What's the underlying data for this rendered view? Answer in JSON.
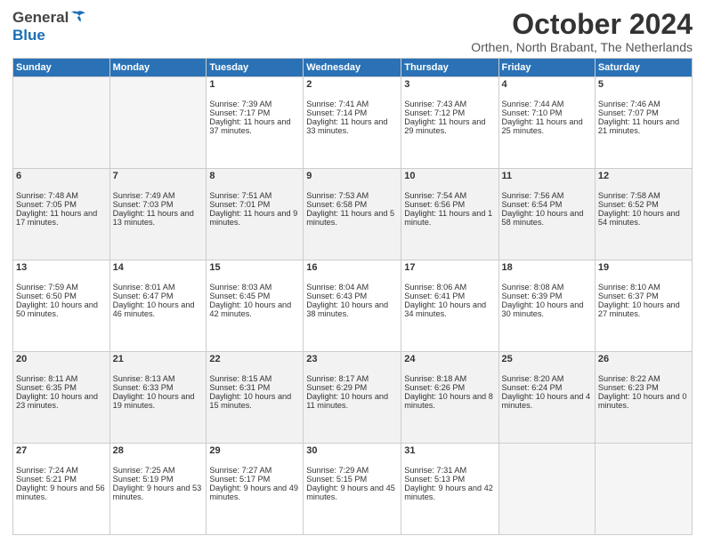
{
  "header": {
    "logo_general": "General",
    "logo_blue": "Blue",
    "title": "October 2024",
    "location": "Orthen, North Brabant, The Netherlands"
  },
  "days_of_week": [
    "Sunday",
    "Monday",
    "Tuesday",
    "Wednesday",
    "Thursday",
    "Friday",
    "Saturday"
  ],
  "weeks": [
    [
      {
        "day": "",
        "empty": true
      },
      {
        "day": "",
        "empty": true
      },
      {
        "day": "1",
        "sunrise": "Sunrise: 7:39 AM",
        "sunset": "Sunset: 7:17 PM",
        "daylight": "Daylight: 11 hours and 37 minutes."
      },
      {
        "day": "2",
        "sunrise": "Sunrise: 7:41 AM",
        "sunset": "Sunset: 7:14 PM",
        "daylight": "Daylight: 11 hours and 33 minutes."
      },
      {
        "day": "3",
        "sunrise": "Sunrise: 7:43 AM",
        "sunset": "Sunset: 7:12 PM",
        "daylight": "Daylight: 11 hours and 29 minutes."
      },
      {
        "day": "4",
        "sunrise": "Sunrise: 7:44 AM",
        "sunset": "Sunset: 7:10 PM",
        "daylight": "Daylight: 11 hours and 25 minutes."
      },
      {
        "day": "5",
        "sunrise": "Sunrise: 7:46 AM",
        "sunset": "Sunset: 7:07 PM",
        "daylight": "Daylight: 11 hours and 21 minutes."
      }
    ],
    [
      {
        "day": "6",
        "sunrise": "Sunrise: 7:48 AM",
        "sunset": "Sunset: 7:05 PM",
        "daylight": "Daylight: 11 hours and 17 minutes."
      },
      {
        "day": "7",
        "sunrise": "Sunrise: 7:49 AM",
        "sunset": "Sunset: 7:03 PM",
        "daylight": "Daylight: 11 hours and 13 minutes."
      },
      {
        "day": "8",
        "sunrise": "Sunrise: 7:51 AM",
        "sunset": "Sunset: 7:01 PM",
        "daylight": "Daylight: 11 hours and 9 minutes."
      },
      {
        "day": "9",
        "sunrise": "Sunrise: 7:53 AM",
        "sunset": "Sunset: 6:58 PM",
        "daylight": "Daylight: 11 hours and 5 minutes."
      },
      {
        "day": "10",
        "sunrise": "Sunrise: 7:54 AM",
        "sunset": "Sunset: 6:56 PM",
        "daylight": "Daylight: 11 hours and 1 minute."
      },
      {
        "day": "11",
        "sunrise": "Sunrise: 7:56 AM",
        "sunset": "Sunset: 6:54 PM",
        "daylight": "Daylight: 10 hours and 58 minutes."
      },
      {
        "day": "12",
        "sunrise": "Sunrise: 7:58 AM",
        "sunset": "Sunset: 6:52 PM",
        "daylight": "Daylight: 10 hours and 54 minutes."
      }
    ],
    [
      {
        "day": "13",
        "sunrise": "Sunrise: 7:59 AM",
        "sunset": "Sunset: 6:50 PM",
        "daylight": "Daylight: 10 hours and 50 minutes."
      },
      {
        "day": "14",
        "sunrise": "Sunrise: 8:01 AM",
        "sunset": "Sunset: 6:47 PM",
        "daylight": "Daylight: 10 hours and 46 minutes."
      },
      {
        "day": "15",
        "sunrise": "Sunrise: 8:03 AM",
        "sunset": "Sunset: 6:45 PM",
        "daylight": "Daylight: 10 hours and 42 minutes."
      },
      {
        "day": "16",
        "sunrise": "Sunrise: 8:04 AM",
        "sunset": "Sunset: 6:43 PM",
        "daylight": "Daylight: 10 hours and 38 minutes."
      },
      {
        "day": "17",
        "sunrise": "Sunrise: 8:06 AM",
        "sunset": "Sunset: 6:41 PM",
        "daylight": "Daylight: 10 hours and 34 minutes."
      },
      {
        "day": "18",
        "sunrise": "Sunrise: 8:08 AM",
        "sunset": "Sunset: 6:39 PM",
        "daylight": "Daylight: 10 hours and 30 minutes."
      },
      {
        "day": "19",
        "sunrise": "Sunrise: 8:10 AM",
        "sunset": "Sunset: 6:37 PM",
        "daylight": "Daylight: 10 hours and 27 minutes."
      }
    ],
    [
      {
        "day": "20",
        "sunrise": "Sunrise: 8:11 AM",
        "sunset": "Sunset: 6:35 PM",
        "daylight": "Daylight: 10 hours and 23 minutes."
      },
      {
        "day": "21",
        "sunrise": "Sunrise: 8:13 AM",
        "sunset": "Sunset: 6:33 PM",
        "daylight": "Daylight: 10 hours and 19 minutes."
      },
      {
        "day": "22",
        "sunrise": "Sunrise: 8:15 AM",
        "sunset": "Sunset: 6:31 PM",
        "daylight": "Daylight: 10 hours and 15 minutes."
      },
      {
        "day": "23",
        "sunrise": "Sunrise: 8:17 AM",
        "sunset": "Sunset: 6:29 PM",
        "daylight": "Daylight: 10 hours and 11 minutes."
      },
      {
        "day": "24",
        "sunrise": "Sunrise: 8:18 AM",
        "sunset": "Sunset: 6:26 PM",
        "daylight": "Daylight: 10 hours and 8 minutes."
      },
      {
        "day": "25",
        "sunrise": "Sunrise: 8:20 AM",
        "sunset": "Sunset: 6:24 PM",
        "daylight": "Daylight: 10 hours and 4 minutes."
      },
      {
        "day": "26",
        "sunrise": "Sunrise: 8:22 AM",
        "sunset": "Sunset: 6:23 PM",
        "daylight": "Daylight: 10 hours and 0 minutes."
      }
    ],
    [
      {
        "day": "27",
        "sunrise": "Sunrise: 7:24 AM",
        "sunset": "Sunset: 5:21 PM",
        "daylight": "Daylight: 9 hours and 56 minutes."
      },
      {
        "day": "28",
        "sunrise": "Sunrise: 7:25 AM",
        "sunset": "Sunset: 5:19 PM",
        "daylight": "Daylight: 9 hours and 53 minutes."
      },
      {
        "day": "29",
        "sunrise": "Sunrise: 7:27 AM",
        "sunset": "Sunset: 5:17 PM",
        "daylight": "Daylight: 9 hours and 49 minutes."
      },
      {
        "day": "30",
        "sunrise": "Sunrise: 7:29 AM",
        "sunset": "Sunset: 5:15 PM",
        "daylight": "Daylight: 9 hours and 45 minutes."
      },
      {
        "day": "31",
        "sunrise": "Sunrise: 7:31 AM",
        "sunset": "Sunset: 5:13 PM",
        "daylight": "Daylight: 9 hours and 42 minutes."
      },
      {
        "day": "",
        "empty": true
      },
      {
        "day": "",
        "empty": true
      }
    ]
  ]
}
